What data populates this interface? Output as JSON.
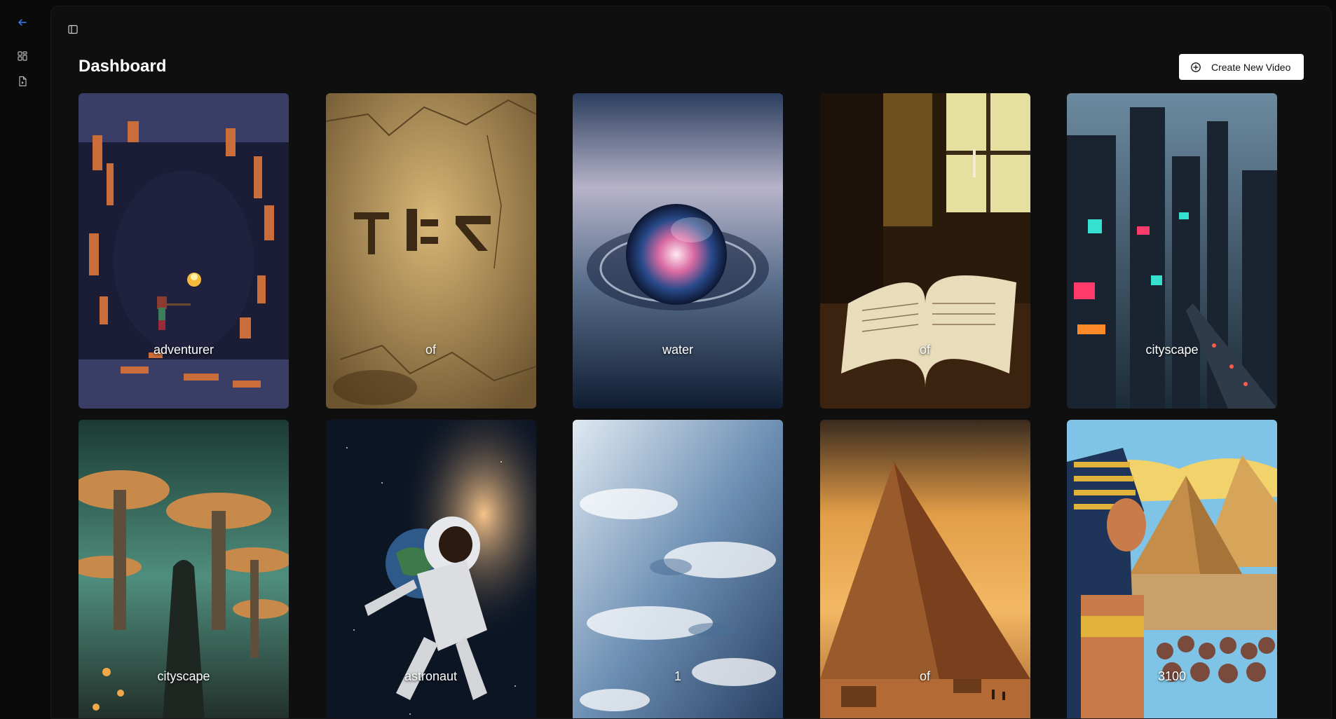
{
  "rail": {
    "items": [
      {
        "icon": "arrow-left-icon",
        "color": "#3b82f6"
      },
      {
        "icon": "dashboard-icon",
        "color": "#b5b5b5"
      },
      {
        "icon": "file-video-icon",
        "color": "#b5b5b5"
      }
    ]
  },
  "header": {
    "title": "Dashboard",
    "create_label": "Create New Video",
    "create_icon": "plus-circle-icon"
  },
  "cards": [
    {
      "label": "adventurer",
      "theme": "pixel-cave-adventurer"
    },
    {
      "label": "of",
      "theme": "carved-stone-script"
    },
    {
      "label": "water",
      "theme": "water-drop-galaxy"
    },
    {
      "label": "of",
      "theme": "open-book-by-window"
    },
    {
      "label": "cityscape",
      "theme": "cyberpunk-city"
    },
    {
      "label": "cityscape",
      "theme": "mushroom-forest"
    },
    {
      "label": "astronaut",
      "theme": "astronaut-in-space"
    },
    {
      "label": "1",
      "theme": "earth-clouds-from-orbit"
    },
    {
      "label": "of",
      "theme": "pyramid-sunset"
    },
    {
      "label": "3100",
      "theme": "pharaoh-comic"
    }
  ],
  "colors": {
    "background": "#0a0a0a",
    "panel": "#0f0f0f",
    "accent": "#3b82f6",
    "button_bg": "#ffffff"
  }
}
